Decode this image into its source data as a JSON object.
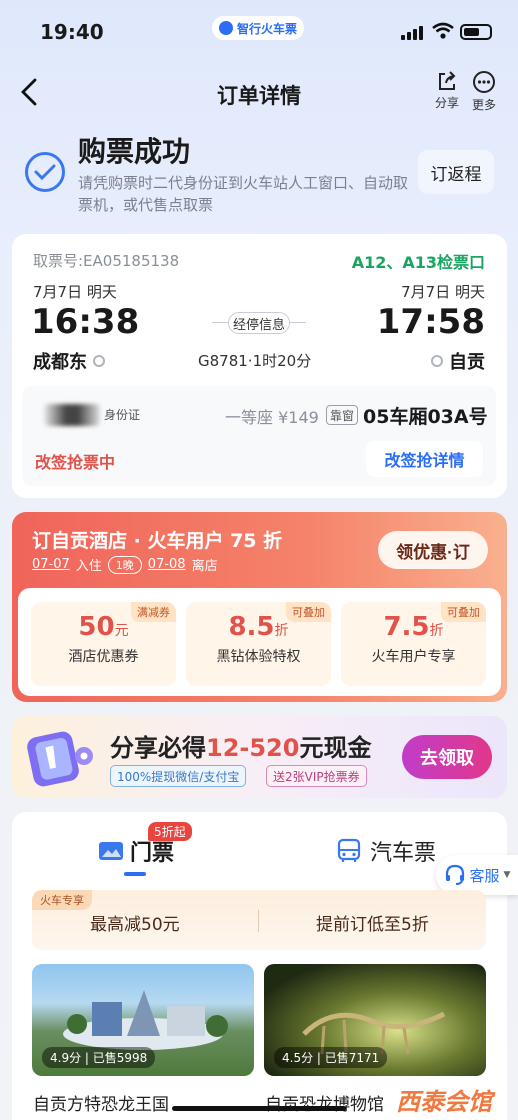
{
  "status": {
    "time": "19:40",
    "app_name": "智行火车票"
  },
  "nav": {
    "title": "订单详情",
    "share_label": "分享",
    "more_label": "更多"
  },
  "success": {
    "title": "购票成功",
    "desc": "请凭购票时二代身份证到火车站人工窗口、自动取票机，或代售点取票",
    "return_button": "订返程"
  },
  "ticket": {
    "ticket_no": "取票号:EA05185138",
    "gate": "A12、A13检票口",
    "dep_date": "7月7日  明天",
    "arr_date": "7月7日  明天",
    "dep_time": "16:38",
    "arr_time": "17:58",
    "stop_info": "经停信息",
    "train_info": "G8781·1时20分",
    "dep_station": "成都东",
    "arr_station": "自贡",
    "id_label": "身份证",
    "seat_class": "一等座 ¥149",
    "window_tag": "靠窗",
    "seat_no": "05车厢03A号",
    "change_status": "改签抢票中",
    "change_button": "改签抢详情"
  },
  "hotel": {
    "title": "订自贡酒店 · 火车用户 75 折",
    "checkin_date": "07-07",
    "checkin_label": "入住",
    "nights": "1晚",
    "checkout_date": "07-08",
    "checkout_label": "离店",
    "button": "领优惠·订",
    "coupons": [
      {
        "tag": "满减券",
        "value": "50",
        "unit": "元",
        "label": "酒店优惠券"
      },
      {
        "tag": "可叠加",
        "value": "8.5",
        "unit": "折",
        "label": "黑钻体验特权"
      },
      {
        "tag": "可叠加",
        "value": "7.5",
        "unit": "折",
        "label": "火车用户专享"
      }
    ]
  },
  "share": {
    "title_prefix": "分享必得",
    "title_highlight": "12-520",
    "title_suffix": "元现金",
    "tag1": "100%提现微信/支付宝",
    "tag2": "送2张VIP抢票券",
    "button": "去领取"
  },
  "bottom": {
    "tab_tickets": "门票",
    "tab_badge": "5折起",
    "tab_bus": "汽车票",
    "service": "客服",
    "deal_tag": "火车专享",
    "deal1": "最高减50元",
    "deal2": "提前订低至5折",
    "attractions": [
      {
        "rating": "4.9分 | 已售5998",
        "name": "自贡方特恐龙王国"
      },
      {
        "rating": "4.5分 | 已售7171",
        "name": "自贡恐龙博物馆"
      }
    ],
    "watermark": "西泰会馆"
  }
}
